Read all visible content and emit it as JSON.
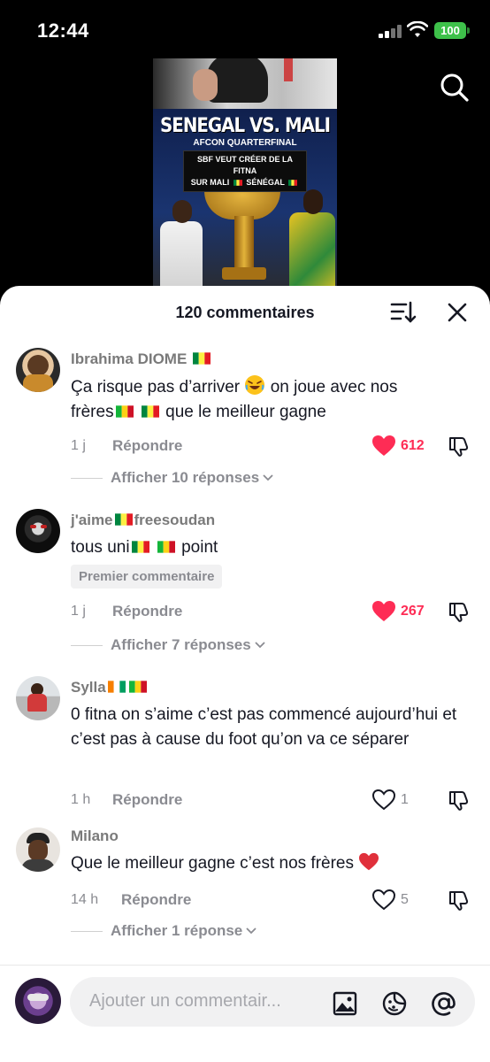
{
  "status_bar": {
    "time": "12:44",
    "battery": "100"
  },
  "video": {
    "title": "SENEGAL VS. MALI",
    "subtitle": "AFCON QUARTERFINAL",
    "caption_line1": "SBF VEUT CRÉER DE LA FITNA",
    "caption_line2_a": "SUR MALI",
    "caption_line2_b": "SÉNÉGAL"
  },
  "header": {
    "title": "120 commentaires"
  },
  "comments": [
    {
      "username": "Ibrahima DIOME",
      "text_1": "Ça risque pas d’arriver",
      "text_2": "on joue avec nos",
      "text_3": "frères",
      "text_4": "que le meilleur gagne",
      "time": "1 j",
      "reply": "Répondre",
      "likes": "612",
      "liked": true,
      "replies_label": "Afficher 10 réponses"
    },
    {
      "username_a": "j'aime",
      "username_b": "freesoudan",
      "text_1": "tous uni",
      "text_2": "point",
      "badge": "Premier commentaire",
      "time": "1 j",
      "reply": "Répondre",
      "likes": "267",
      "liked": true,
      "replies_label": "Afficher 7 réponses"
    },
    {
      "username": "Sylla",
      "text": "0 fitna on s’aime c’est pas commencé aujourd’hui et c’est pas à cause du foot qu’on va ce séparer",
      "time": "1 h",
      "reply": "Répondre",
      "likes": "1",
      "liked": false
    },
    {
      "username": "Milano",
      "text": "Que le meilleur gagne c’est nos frères",
      "time": "14 h",
      "reply": "Répondre",
      "likes": "5",
      "liked": false,
      "replies_label": "Afficher 1 réponse"
    }
  ],
  "composer": {
    "placeholder": "Ajouter un commentair..."
  },
  "colors": {
    "like_red": "#fe2c55",
    "muted": "#8a8b91",
    "text": "#161823"
  },
  "icons": [
    "search-icon",
    "sort-icon",
    "close-icon",
    "heart-icon",
    "dislike-icon",
    "chevron-down-icon",
    "image-icon",
    "sticker-icon",
    "mention-icon"
  ]
}
